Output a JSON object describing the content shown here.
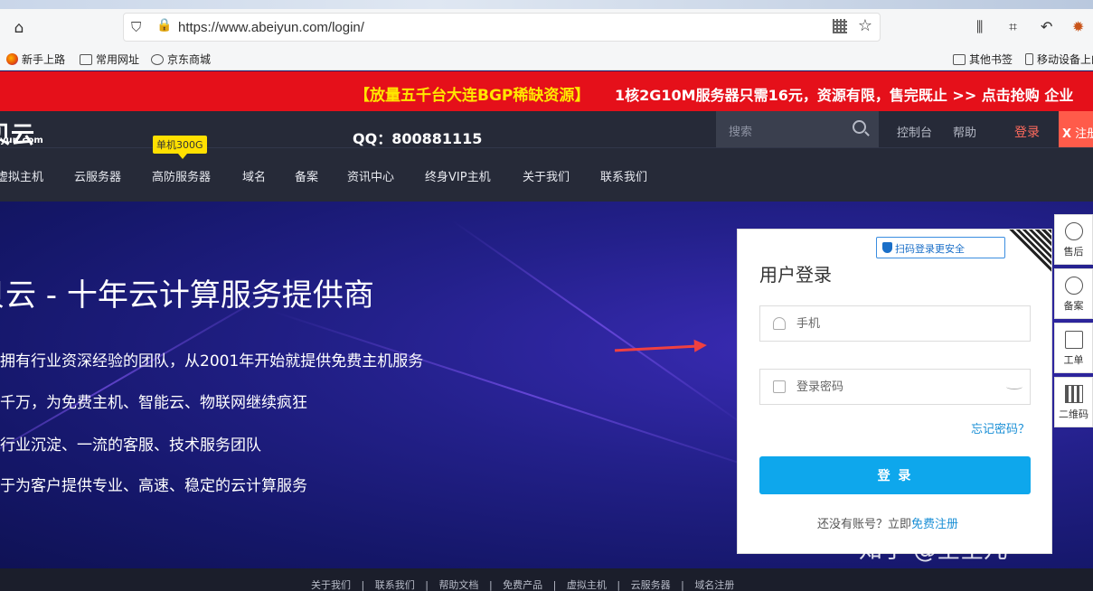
{
  "browser": {
    "url": "https://www.abeiyun.com/login/",
    "bookmarks": [
      {
        "label": "新手上路",
        "icon": "firefox-icon"
      },
      {
        "label": "常用网址",
        "icon": "folder-icon"
      },
      {
        "label": "京东商城",
        "icon": "globe-icon"
      }
    ],
    "bookmarks_right": [
      {
        "label": "其他书签",
        "icon": "folder-icon"
      },
      {
        "label": "移动设备上的",
        "icon": "phone-icon"
      }
    ]
  },
  "promo": {
    "tag": "【放量五千台大连BGP稀缺资源】",
    "text": "1核2G10M服务器只需16元，资源有限，售完既止 >> 点击抢购  企业"
  },
  "header": {
    "logo_main": "贝云",
    "logo_sub": "yun.com",
    "qq": "QQ：800881115",
    "search_placeholder": "搜索",
    "links": [
      "控制台",
      "帮助"
    ],
    "login": "登录",
    "register": "注册",
    "register_prefix": "X",
    "badge": "单机300G",
    "nav": [
      "虚拟主机",
      "云服务器",
      "高防服务器",
      "域名",
      "备案",
      "资讯中心",
      "终身VIP主机",
      "关于我们",
      "联系我们"
    ]
  },
  "hero": {
    "title": "贝云 - 十年云计算服务提供商",
    "lines": [
      "拥有行业资深经验的团队，从2001年开始就提供免费主机服务",
      "千万，为免费主机、智能云、物联网继续疯狂",
      "行业沉淀、一流的客服、技术服务团队",
      "于为客户提供专业、高速、稳定的云计算服务"
    ]
  },
  "login_panel": {
    "scan_tip": "扫码登录更安全",
    "title": "用户登录",
    "phone_placeholder": "手机",
    "password_placeholder": "登录密码",
    "forgot": "忘记密码？",
    "submit": "登 录",
    "no_account": "还没有账号？立即",
    "free_register": "免费注册"
  },
  "side": [
    "售后",
    "备案",
    "工单",
    "二维码"
  ],
  "watermark": "知乎 @空空儿",
  "footer": [
    "关于我们",
    "|",
    "联系我们",
    "|",
    "帮助文档",
    "|",
    "免费产品",
    "|",
    "虚拟主机",
    "|",
    "云服务器",
    "|",
    "域名注册"
  ]
}
